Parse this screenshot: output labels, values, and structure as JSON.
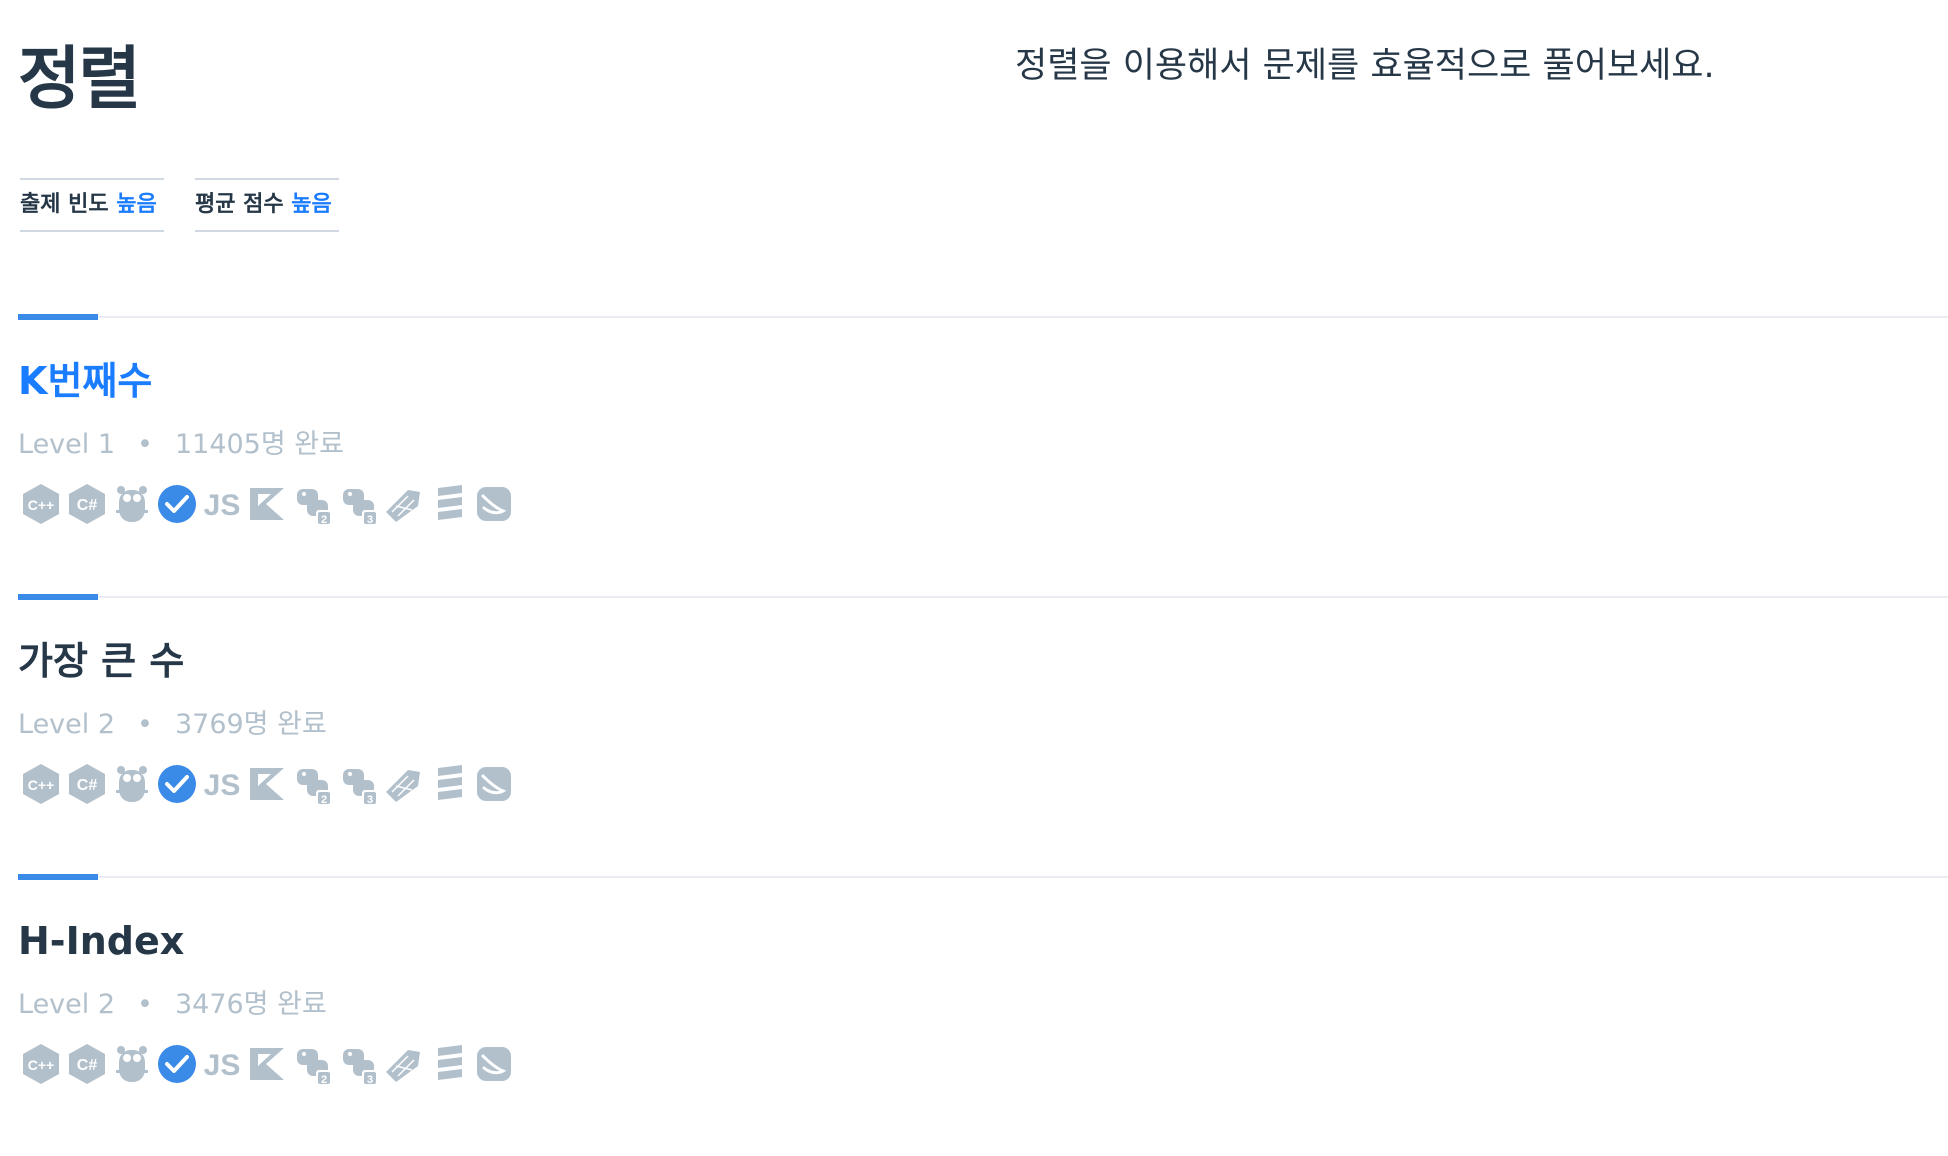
{
  "page": {
    "title": "정렬",
    "description": "정렬을 이용해서 문제를 효율적으로 풀어보세요."
  },
  "tags": [
    {
      "label": "출제 빈도",
      "level": "높음"
    },
    {
      "label": "평균 점수",
      "level": "높음"
    }
  ],
  "problems": [
    {
      "title": "K번째수",
      "level": "Level 1",
      "completed": "11405명 완료"
    },
    {
      "title": "가장 큰 수",
      "level": "Level 2",
      "completed": "3769명 완료"
    },
    {
      "title": "H-Index",
      "level": "Level 2",
      "completed": "3476명 완료"
    }
  ],
  "meta_separator": "•",
  "languages": [
    "c-icon",
    "csharp-icon",
    "go-icon",
    "java-icon",
    "javascript-icon",
    "kotlin-icon",
    "python2-icon",
    "python3-icon",
    "ruby-icon",
    "scala-icon",
    "swift-icon"
  ],
  "language_glyphs": {
    "c": "C++",
    "csharp": "C#",
    "javascript": "JS",
    "python2": "2",
    "python3": "3"
  },
  "colors": {
    "accent": "#1a7cff",
    "text": "#263747",
    "muted": "#b2c0cc",
    "icon": "#b2c0cc",
    "check": "#3a8ae8"
  }
}
